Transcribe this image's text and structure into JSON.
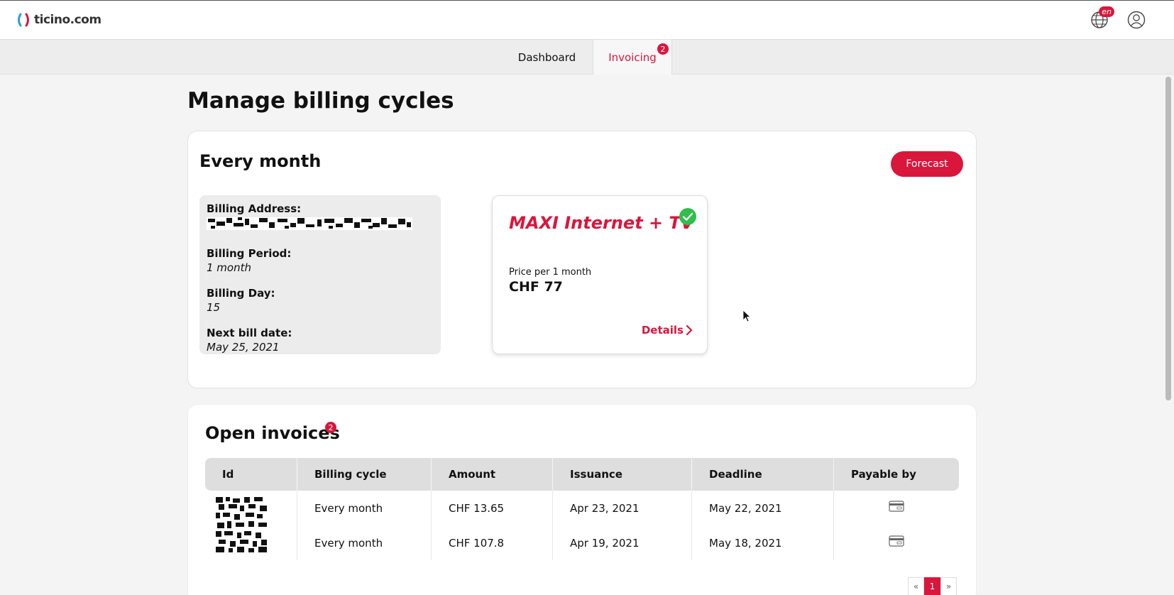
{
  "header": {
    "logo_text": "ticino.com",
    "lang_badge": "en",
    "globe_icon": "globe-icon",
    "user_icon": "user-icon"
  },
  "tabs": [
    {
      "label": "Dashboard",
      "active": false
    },
    {
      "label": "Invoicing",
      "active": true,
      "badge": "2"
    }
  ],
  "page": {
    "title": "Manage billing cycles"
  },
  "cycle": {
    "title": "Every month",
    "forecast_label": "Forecast",
    "billing_address_label": "Billing Address:",
    "billing_period_label": "Billing Period:",
    "billing_period_value": "1 month",
    "billing_day_label": "Billing Day:",
    "billing_day_value": "15",
    "next_bill_label": "Next bill date:",
    "next_bill_value": "May 25, 2021"
  },
  "product": {
    "name": "MAXI Internet + TV",
    "price_label": "Price per 1 month",
    "price_value": "CHF 77",
    "details_label": "Details"
  },
  "invoices": {
    "title": "Open invoices",
    "badge": "2",
    "columns": [
      "Id",
      "Billing cycle",
      "Amount",
      "Issuance",
      "Deadline",
      "Payable by"
    ],
    "rows": [
      {
        "billing_cycle": "Every month",
        "amount": "CHF 13.65",
        "issuance": "Apr 23, 2021",
        "deadline": "May 22, 2021",
        "payable_icon": "credit-card-icon"
      },
      {
        "billing_cycle": "Every month",
        "amount": "CHF 107.8",
        "issuance": "Apr 19, 2021",
        "deadline": "May 18, 2021",
        "payable_icon": "credit-card-icon"
      }
    ]
  },
  "pagination": {
    "prev": "«",
    "current": "1",
    "next": "»"
  },
  "colors": {
    "accent": "#d9163c",
    "success": "#2fbf4a"
  }
}
